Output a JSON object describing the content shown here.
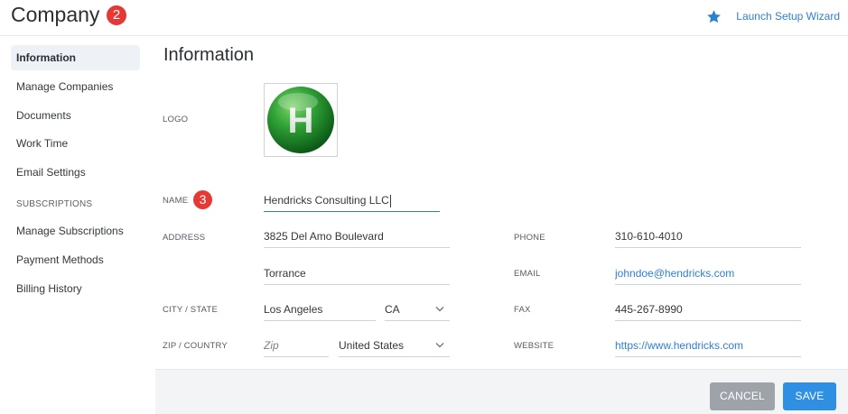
{
  "header": {
    "title": "Company",
    "title_badge": "2",
    "wizard_label": "Launch Setup Wizard"
  },
  "sidebar": {
    "items": [
      {
        "label": "Information",
        "active": true
      },
      {
        "label": "Manage Companies"
      },
      {
        "label": "Documents"
      },
      {
        "label": "Work Time"
      },
      {
        "label": "Email Settings"
      }
    ],
    "section_label": "SUBSCRIPTIONS",
    "sub_items": [
      {
        "label": "Manage Subscriptions"
      },
      {
        "label": "Payment Methods"
      },
      {
        "label": "Billing History"
      }
    ]
  },
  "main": {
    "page_title": "Information",
    "logo_label": "LOGO",
    "logo_letter": "H",
    "name_label": "NAME",
    "name_badge": "3",
    "name_value": "Hendricks Consulting LLC",
    "address_label": "ADDRESS",
    "address_line1": "3825 Del Amo Boulevard",
    "address_line2": "Torrance",
    "city_state_label": "CITY / STATE",
    "city": "Los Angeles",
    "state": "CA",
    "zip_country_label": "ZIP / COUNTRY",
    "zip_placeholder": "Zip",
    "country": "United States",
    "phone_label": "PHONE",
    "phone": "310-610-4010",
    "email_label": "EMAIL",
    "email": "johndoe@hendricks.com",
    "fax_label": "FAX",
    "fax": "445-267-8990",
    "website_label": "WEBSITE",
    "website": "https://www.hendricks.com"
  },
  "footer": {
    "cancel_label": "CANCEL",
    "save_label": "SAVE"
  },
  "colors": {
    "accent": "#2f7fd1",
    "badge": "#e53935",
    "save_button": "#2e8fe3",
    "cancel_button": "#9ea3a9"
  }
}
